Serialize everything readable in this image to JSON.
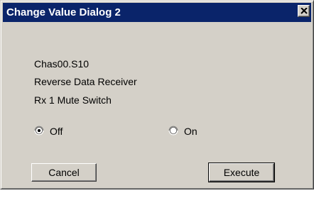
{
  "window": {
    "title": "Change Value Dialog 2",
    "close_icon": "close-x-icon"
  },
  "info": {
    "line1": "Chas00.S10",
    "line2": "Reverse Data Receiver",
    "line3": "Rx 1 Mute Switch"
  },
  "options": {
    "off_label": "Off",
    "on_label": "On",
    "selected": "Off"
  },
  "buttons": {
    "cancel_label": "Cancel",
    "execute_label": "Execute"
  }
}
